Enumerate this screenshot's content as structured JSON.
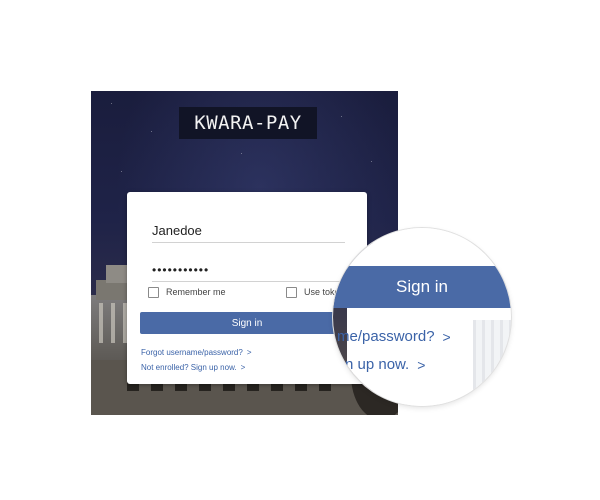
{
  "app": {
    "logo_text": "KWARA-PAY"
  },
  "login": {
    "username_value": "Janedoe",
    "password_value": "•••••••••••",
    "remember_label": "Remember me",
    "token_label": "Use toke",
    "signin_label": "Sign in",
    "forgot_label": "Forgot username/password?",
    "enroll_label": "Not enrolled? Sign up now.",
    "chevron": ">"
  },
  "magnifier": {
    "signin_label": "Sign in",
    "forgot_fragment": "me/password?",
    "enroll_fragment": "n up now.",
    "chevron": ">"
  },
  "colors": {
    "accent": "#4a6aa6",
    "link": "#3b63a8",
    "night_sky": "#1f2348"
  },
  "icons": [
    "checkbox-icon",
    "chevron-right-icon"
  ]
}
